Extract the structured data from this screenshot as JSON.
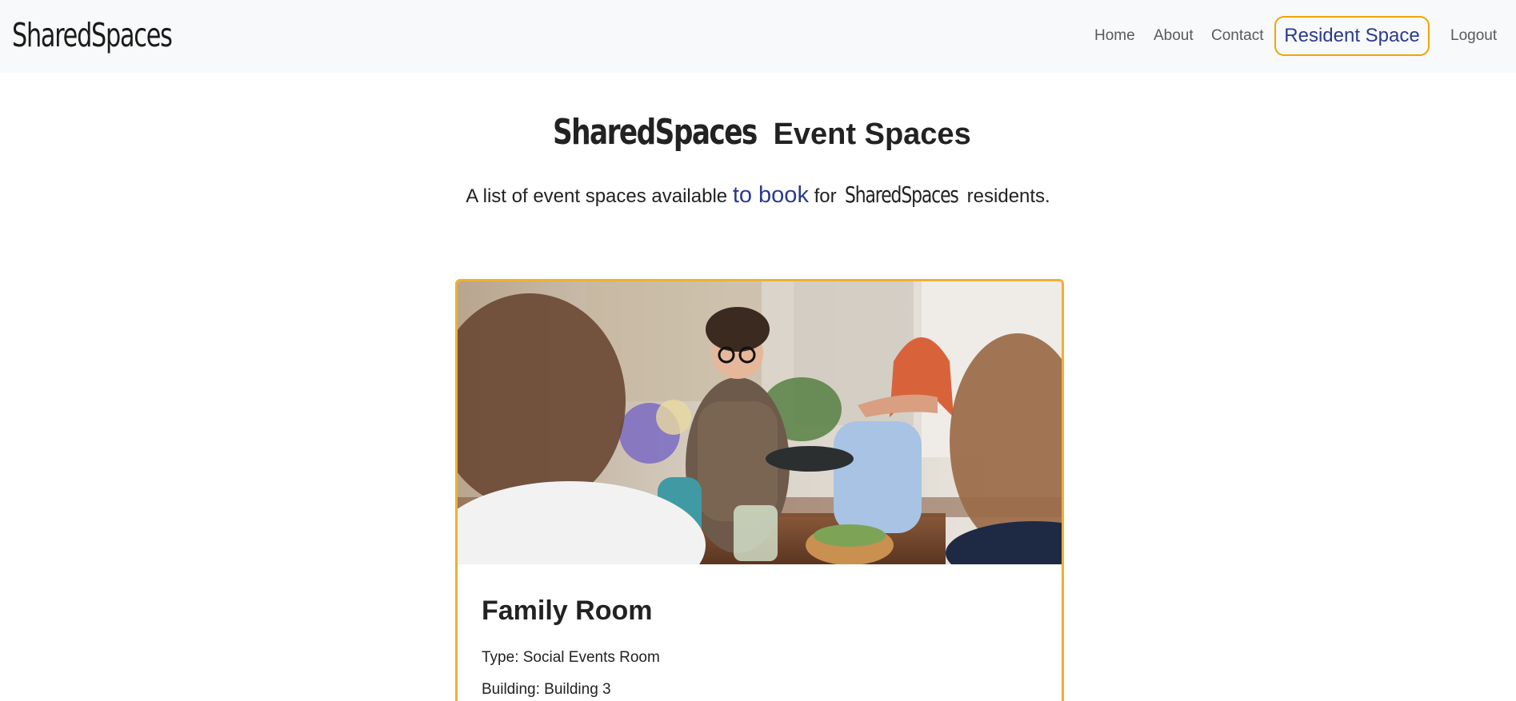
{
  "navbar": {
    "brand": "SharedSpaces",
    "links": {
      "home": "Home",
      "about": "About",
      "contact": "Contact",
      "resident_space": "Resident Space",
      "logout": "Logout"
    }
  },
  "header": {
    "title_logo": "SharedSpaces",
    "title_rest": " Event Spaces",
    "subtitle_pre": "A list of event spaces available ",
    "subtitle_link": "to book",
    "subtitle_mid": " for ",
    "subtitle_logo": "SharedSpaces",
    "subtitle_post": " residents."
  },
  "spaces": [
    {
      "name": "Family Room",
      "type_line": "Type: Social Events Room",
      "building_line": "Building: Building 3"
    }
  ],
  "colors": {
    "accent_border": "#f0a500",
    "link_blue": "#2b3a8c",
    "navbar_bg": "#f8f9fa"
  }
}
